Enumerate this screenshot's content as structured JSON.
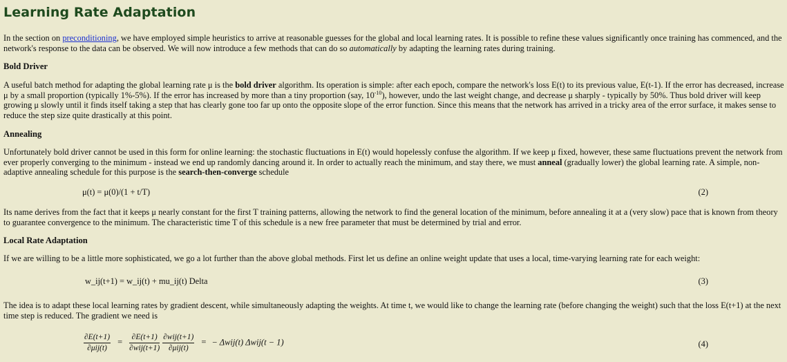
{
  "title": "Learning Rate Adaptation",
  "intro": {
    "before_link": "In the section on ",
    "link": "preconditioning",
    "after_link": ", we have employed simple heuristics to arrive at reasonable guesses for the global and local learning rates. It is possible to refine these values significantly once training has commenced, and the network's response to the data can be observed. We will now introduce a few methods that can do so ",
    "emph": "automatically",
    "end": " by adapting the learning rates during training."
  },
  "bold_driver": {
    "heading": "Bold Driver",
    "p1_a": "A useful batch method for adapting the global learning rate μ is the ",
    "p1_bold": "bold driver",
    "p1_b": " algorithm. Its operation is simple: after each epoch, compare the network's loss E(t) to its previous value, E(t-1). If the error has decreased, increase μ by a small proportion (typically 1%-5%). If the error has increased by more than a tiny proportion (say, 10",
    "p1_sup": "-10",
    "p1_c": "), however, undo the last weight change, and decrease μ sharply - typically by 50%. Thus bold driver will keep growing μ slowly until it finds itself taking a step that has clearly gone too far up onto the opposite slope of the error function. Since this means that the network has arrived in a tricky area of the error surface, it makes sense to reduce the step size quite drastically at this point."
  },
  "annealing": {
    "heading": "Annealing",
    "p1_a": "Unfortunately bold driver cannot be used in this form for online learning: the stochastic fluctuations in E(t) would hopelessly confuse the algorithm. If we keep μ fixed, however, these same fluctuations prevent the network from ever properly converging to the minimum - instead we end up randomly dancing around it. In order to actually reach the minimum, and stay there, we must ",
    "p1_bold": "anneal",
    "p1_b": " (gradually lower) the global learning rate. A simple, non-adaptive annealing schedule for this purpose is the ",
    "p1_bold2": "search-then-converge",
    "p1_c": " schedule",
    "eq2": "μ(t) = μ(0)/(1 + t/T)",
    "eq2_num": "(2)",
    "p2": "Its name derives from the fact that it keeps μ nearly constant for the first T training patterns, allowing the network to find the general location of the minimum, before annealing it at a (very slow) pace that is known from theory to guarantee convergence to the minimum. The characteristic time T of this schedule is a new free parameter that must be determined by trial and error."
  },
  "local": {
    "heading": "Local Rate Adaptation",
    "p1": "If we are willing to be a little more sophisticated, we go a lot further than the above global methods. First let us define an online weight update that uses a local, time-varying learning rate for each weight:",
    "eq3": "w_ij(t+1) = w_ij(t) + mu_ij(t) Delta",
    "eq3_num": "(3)",
    "p2": "The idea is to adapt these local learning rates by gradient descent, while simultaneously adapting the weights. At time t, we would like to change the learning rate (before changing the weight) such that the loss E(t+1) at the next time step is reduced. The gradient we need is",
    "eq4": {
      "f1_top": "∂E(t+1)",
      "f1_bot": "∂μij(t)",
      "eq_sign": "=",
      "f2_top": "∂E(t+1)",
      "f2_bot": "∂wij(t+1)",
      "f3_top": "∂wij(t+1)",
      "f3_bot": "∂μij(t)",
      "eq_sign2": "=",
      "rhs": "− Δwij(t) Δwij(t − 1)"
    },
    "eq4_num": "(4)"
  }
}
